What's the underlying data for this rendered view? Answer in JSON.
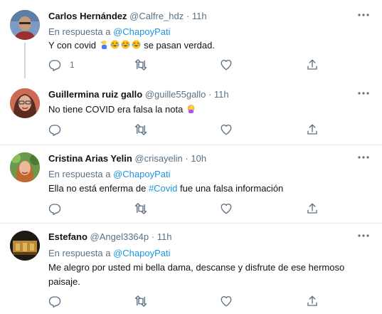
{
  "tweets": [
    {
      "name": "Carlos Hernández",
      "handle": "@Calfre_hdz",
      "dot": "·",
      "time": "11h",
      "reply_prefix": "En respuesta a",
      "reply_mention": "@ChapoyPati",
      "text_before": "Y con covid",
      "text_after": "se pasan verdad.",
      "emojis": [
        "person-facepalming",
        "face-with-tears-of-joy",
        "face-with-tears-of-joy",
        "face-with-tears-of-joy"
      ],
      "reply_count": "1",
      "avatar_bg": "#6a8bb0"
    },
    {
      "name": "Guillermina ruiz gallo",
      "handle": "@guille55gallo",
      "dot": "·",
      "time": "11h",
      "text_before": "No tiene COVID era falsa la nota",
      "emojis": [
        "woman-facepalming"
      ],
      "avatar_bg": "#b05a4a"
    },
    {
      "name": "Cristina Arias Yelin",
      "handle": "@crisayelin",
      "dot": "·",
      "time": "10h",
      "reply_prefix": "En respuesta a",
      "reply_mention": "@ChapoyPati",
      "text_before": "Ella no está enferma de",
      "hashtag": "#Covid",
      "text_after": "fue una falsa información",
      "avatar_bg": "#4f7a3a"
    },
    {
      "name": "Estefano",
      "handle": "@Angel3364p",
      "dot": "·",
      "time": "11h",
      "reply_prefix": "En respuesta a",
      "reply_mention": "@ChapoyPati",
      "text_line1": "Me alegro por usted mi bella dama, descanse y disfrute de ese hermoso",
      "text_line2": "paisaje.",
      "avatar_bg": "#2a2418"
    }
  ],
  "colors": {
    "link": "#1b95e0",
    "secondary_text": "#5b7083",
    "border": "#e6ecf0"
  }
}
